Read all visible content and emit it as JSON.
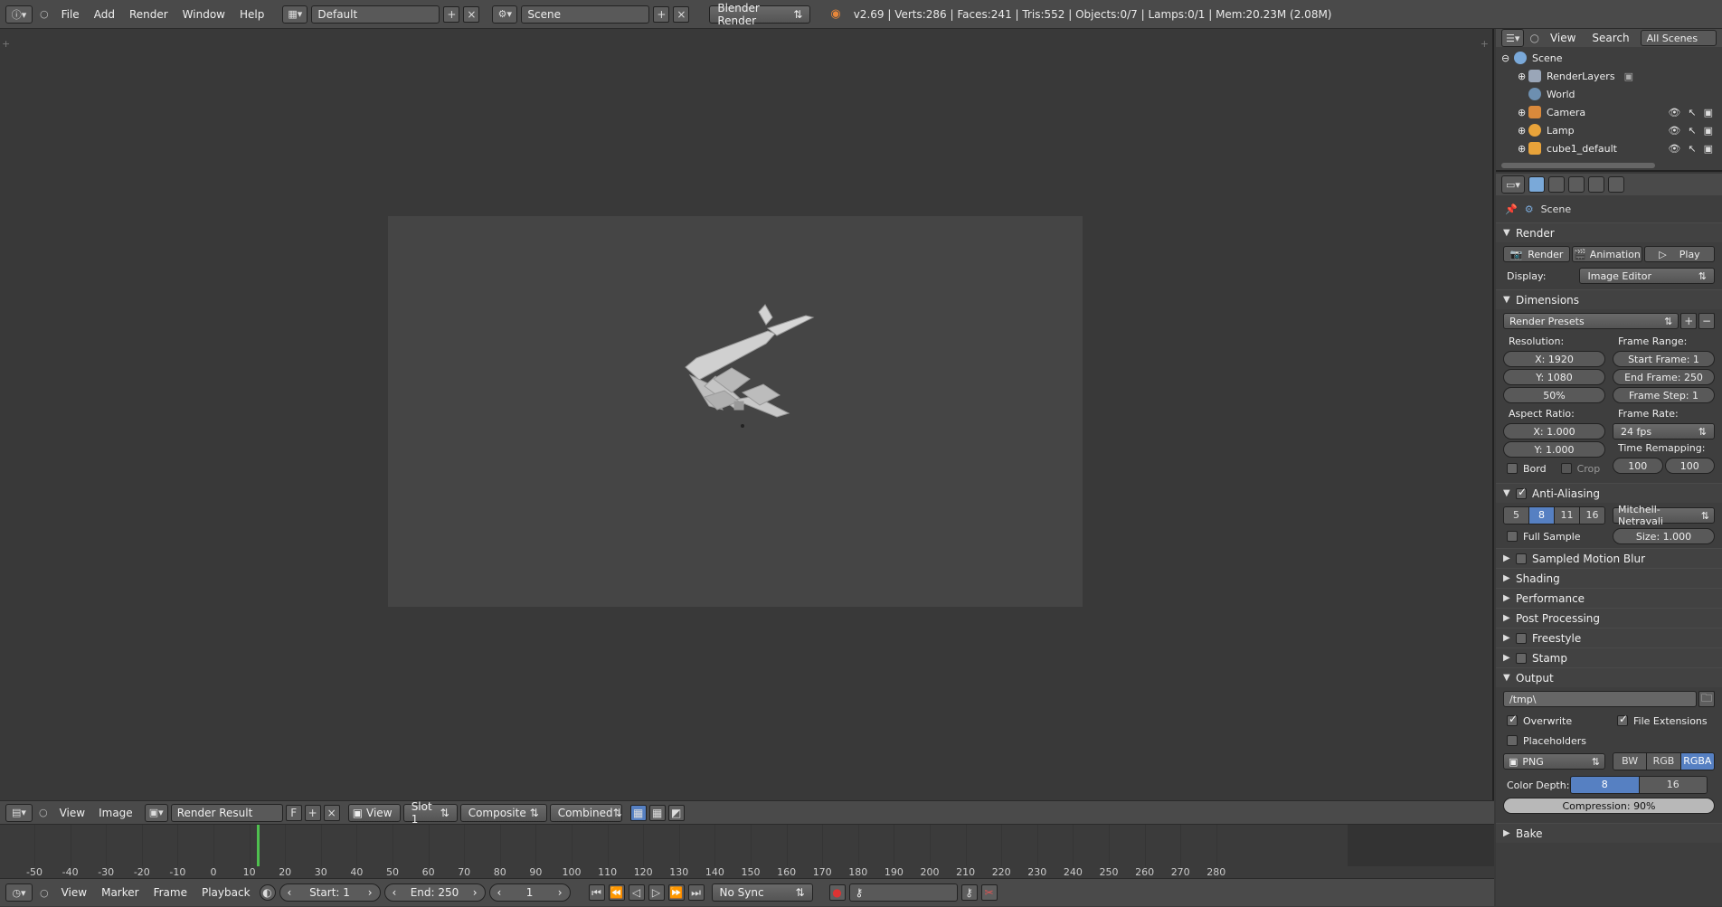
{
  "topbar": {
    "menus": [
      "File",
      "Add",
      "Render",
      "Window",
      "Help"
    ],
    "screen_layout": "Default",
    "scene": "Scene",
    "engine": "Blender Render",
    "stats": "v2.69 | Verts:286 | Faces:241 | Tris:552 | Objects:0/7 | Lamps:0/1 | Mem:20.23M (2.08M)"
  },
  "editor_header": {
    "menus": [
      "View",
      "Image"
    ],
    "image_name": "Render Result",
    "fake_user": "F",
    "view_dropdown": "View",
    "slot": "Slot 1",
    "layer": "Composite",
    "pass": "Combined"
  },
  "timeline": {
    "ticks": [
      "-50",
      "-40",
      "-30",
      "-20",
      "-10",
      "0",
      "10",
      "20",
      "30",
      "40",
      "50",
      "60",
      "70",
      "80",
      "90",
      "100",
      "110",
      "120",
      "130",
      "140",
      "150",
      "160",
      "170",
      "180",
      "190",
      "200",
      "210",
      "220",
      "230",
      "240",
      "250",
      "260",
      "270",
      "280"
    ],
    "menus": [
      "View",
      "Marker",
      "Frame",
      "Playback"
    ],
    "start": "Start: 1",
    "end": "End: 250",
    "current": "1",
    "sync": "No Sync"
  },
  "outliner": {
    "menus": [
      "View",
      "Search"
    ],
    "filter": "All Scenes",
    "items": [
      {
        "label": "Scene",
        "color": "#7aa9d9"
      },
      {
        "label": "RenderLayers",
        "color": "#9aa6b8"
      },
      {
        "label": "World",
        "color": "#6d8fb0"
      },
      {
        "label": "Camera",
        "color": "#d9893b"
      },
      {
        "label": "Lamp",
        "color": "#e8a33a"
      },
      {
        "label": "cube1_default",
        "color": "#e8a33a"
      }
    ]
  },
  "properties": {
    "context": "Scene",
    "render": {
      "title": "Render",
      "render_btn": "Render",
      "animation_btn": "Animation",
      "play_btn": "Play",
      "display_label": "Display:",
      "display_value": "Image Editor"
    },
    "dimensions": {
      "title": "Dimensions",
      "presets": "Render Presets",
      "resolution_label": "Resolution:",
      "res_x": "X: 1920",
      "res_y": "Y: 1080",
      "res_pct": "50%",
      "frame_range_label": "Frame Range:",
      "start_frame": "Start Frame: 1",
      "end_frame": "End Frame: 250",
      "frame_step": "Frame Step: 1",
      "aspect_label": "Aspect Ratio:",
      "aspect_x": "X: 1.000",
      "aspect_y": "Y: 1.000",
      "frame_rate_label": "Frame Rate:",
      "fps": "24 fps",
      "time_remap_label": "Time Remapping:",
      "remap_old": "100",
      "remap_new": "100",
      "bord": "Bord",
      "crop": "Crop"
    },
    "aa": {
      "title": "Anti-Aliasing",
      "samples": [
        "5",
        "8",
        "11",
        "16"
      ],
      "filter": "Mitchell-Netravali",
      "full_sample": "Full Sample",
      "size": "Size: 1.000"
    },
    "collapsed": [
      "Sampled Motion Blur",
      "Shading",
      "Performance",
      "Post Processing",
      "Freestyle",
      "Stamp"
    ],
    "output": {
      "title": "Output",
      "path": "/tmp\\",
      "overwrite": "Overwrite",
      "file_ext": "File Extensions",
      "placeholders": "Placeholders",
      "format": "PNG",
      "bw": "BW",
      "rgb": "RGB",
      "rgba": "RGBA",
      "color_depth_label": "Color Depth:",
      "depth_8": "8",
      "depth_16": "16",
      "compression": "Compression: 90%"
    },
    "bake": "Bake"
  }
}
